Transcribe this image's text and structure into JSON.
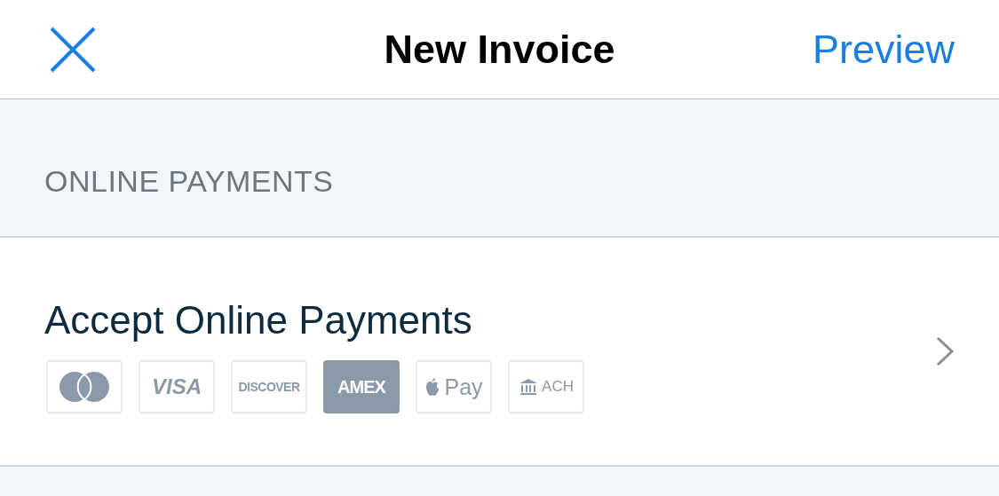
{
  "header": {
    "title": "New Invoice",
    "action": "Preview"
  },
  "section": {
    "heading": "ONLINE PAYMENTS"
  },
  "row": {
    "title": "Accept Online Payments",
    "cards": [
      {
        "kind": "mastercard",
        "filled": false
      },
      {
        "kind": "visa",
        "label": "VISA",
        "filled": false
      },
      {
        "kind": "discover",
        "label": "DISCOVER",
        "filled": false
      },
      {
        "kind": "amex",
        "label": "AMEX",
        "filled": true
      },
      {
        "kind": "applepay",
        "label": "Pay",
        "filled": false
      },
      {
        "kind": "ach",
        "label": "ACH",
        "filled": false
      }
    ]
  }
}
